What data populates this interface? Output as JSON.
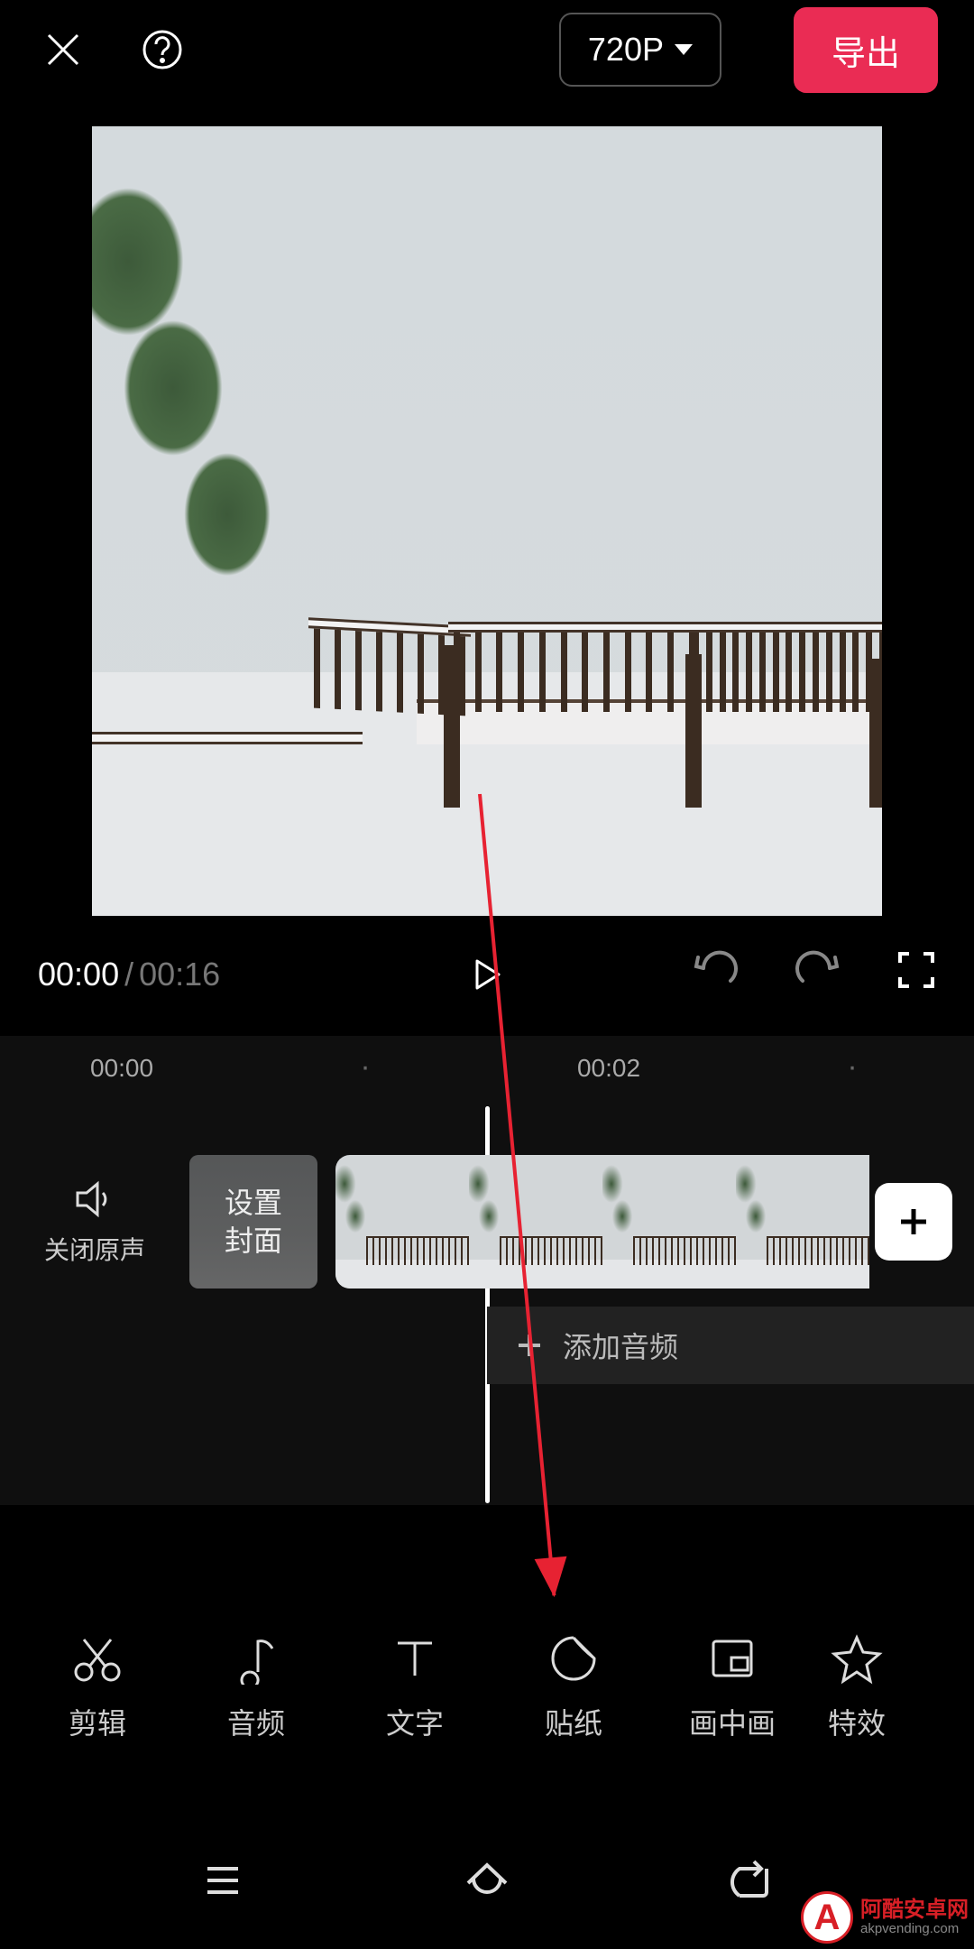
{
  "header": {
    "resolution_label": "720P",
    "export_label": "导出"
  },
  "playback": {
    "current_time": "00:00",
    "separator": "/",
    "total_time": "00:16"
  },
  "timeline": {
    "ticks": [
      "00:00",
      "·",
      "00:02",
      "·"
    ],
    "mute_label": "关闭原声",
    "cover_label_line1": "设置",
    "cover_label_line2": "封面",
    "add_audio_label": "添加音频"
  },
  "tools": [
    {
      "id": "cut",
      "label": "剪辑"
    },
    {
      "id": "audio",
      "label": "音频"
    },
    {
      "id": "text",
      "label": "文字"
    },
    {
      "id": "sticker",
      "label": "贴纸"
    },
    {
      "id": "pip",
      "label": "画中画"
    },
    {
      "id": "fx",
      "label": "特效"
    }
  ],
  "watermark": {
    "letter": "A",
    "name": "阿酷安卓网",
    "url": "akpvending.com"
  }
}
